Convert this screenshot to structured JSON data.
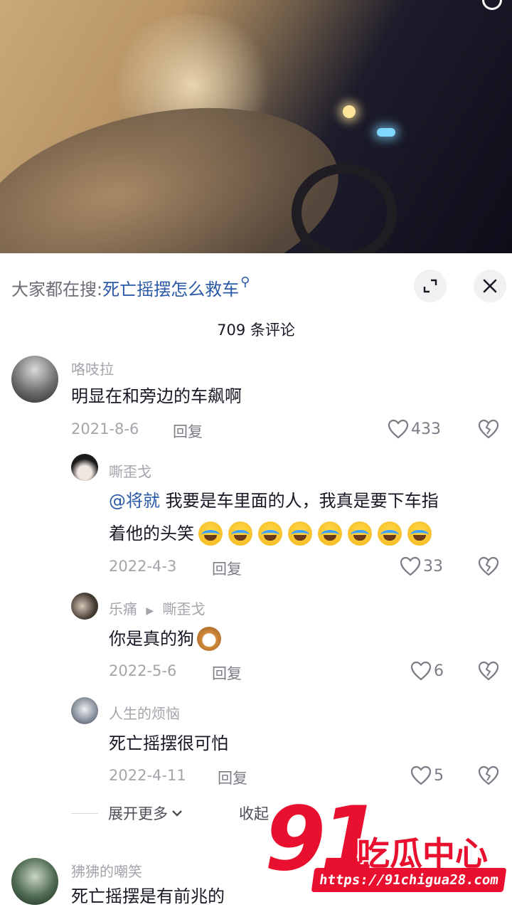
{
  "search_bar": {
    "prefix": "大家都在搜:",
    "query": "死亡摇摆怎么救车"
  },
  "comment_count": "709 条评论",
  "comments": [
    {
      "name": "咯吱拉",
      "text": "明显在和旁边的车飙啊",
      "date": "2021-8-6",
      "reply": "回复",
      "likes": "433"
    },
    {
      "name": "嘶歪戈",
      "mention": "@将就",
      "text_line1": "我要是车里面的人，我真是要下车指",
      "text_line2": "着他的头笑",
      "date": "2022-4-3",
      "reply": "回复",
      "likes": "33"
    },
    {
      "name": "乐痛",
      "reply_to": "嘶歪戈",
      "text": "你是真的狗",
      "date": "2022-5-6",
      "reply": "回复",
      "likes": "6"
    },
    {
      "name": "人生的烦恼",
      "text": "死亡摇摆很可怕",
      "date": "2022-4-11",
      "reply": "回复",
      "likes": "5"
    },
    {
      "name": "狒狒的嘲笑",
      "text": "死亡摇摆是有前兆的"
    }
  ],
  "expand_more": "展开更多",
  "collapse": "收起",
  "watermark": {
    "number": "91",
    "title": "吃瓜中心",
    "url": "https://91chigua28.com"
  },
  "colors": {
    "accent_blue": "#2a5aa8",
    "watermark_red": "#e8102e"
  }
}
